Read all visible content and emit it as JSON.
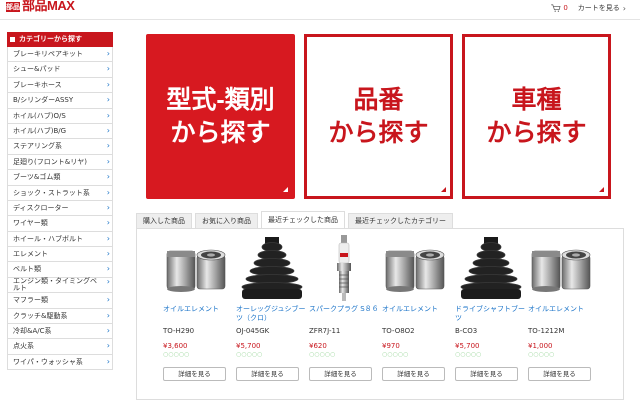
{
  "header": {
    "logo_badge": "部品",
    "logo_text": "部品MAX",
    "cart_count": "0",
    "cart_label": "カートを見る"
  },
  "sidebar": {
    "title": "カテゴリーから探す",
    "items": [
      {
        "label": "ブレーキリペアキット"
      },
      {
        "label": "シュー&パッド"
      },
      {
        "label": "ブレーキホース"
      },
      {
        "label": "B/シリンダーASSY"
      },
      {
        "label": "ホイル(ハブ)O/S"
      },
      {
        "label": "ホイル(ハブ)B/G"
      },
      {
        "label": "ステアリング系"
      },
      {
        "label": "足廻り(フロント&リヤ)"
      },
      {
        "label": "ブーツ&ゴム類"
      },
      {
        "label": "ショック・ストラット系"
      },
      {
        "label": "ディスクローター"
      },
      {
        "label": "ワイヤー類"
      },
      {
        "label": "ホイール・ハブボルト"
      },
      {
        "label": "エレメント"
      },
      {
        "label": "ベルト類"
      },
      {
        "label": "エンジン類・タイミングベルト"
      },
      {
        "label": "マフラー類"
      },
      {
        "label": "クラッチ&駆動系"
      },
      {
        "label": "冷却&A/C系"
      },
      {
        "label": "点火系"
      },
      {
        "label": "ワイパ・ウォッシャ系"
      }
    ]
  },
  "search_buttons": [
    {
      "line1": "型式-類別",
      "line2": "から探す"
    },
    {
      "line1": "品番",
      "line2": "から探す"
    },
    {
      "line1": "車種",
      "line2": "から探す"
    }
  ],
  "tabs": [
    {
      "label": "購入した商品"
    },
    {
      "label": "お気に入り商品"
    },
    {
      "label": "最近チェックした商品"
    },
    {
      "label": "最近チェックしたカテゴリー"
    }
  ],
  "products": [
    {
      "name": "オイルエレメント",
      "code": "TO-H290",
      "price": "¥3,600",
      "image_icon": "oil-filter-icon",
      "stars": "○○○○○",
      "button": "詳細を見る"
    },
    {
      "name": "オーレッグジュシブーツ（クロ）",
      "code": "OJ-045GK",
      "price": "¥5,700",
      "image_icon": "cv-boot-icon",
      "stars": "○○○○○",
      "button": "詳細を見る"
    },
    {
      "name": "スパークプラグ S８６",
      "code": "ZFR7J-11",
      "price": "¥620",
      "image_icon": "spark-plug-icon",
      "stars": "○○○○○",
      "button": "詳細を見る"
    },
    {
      "name": "オイルエレメント",
      "code": "TO-O8O2",
      "price": "¥970",
      "image_icon": "oil-filter-icon",
      "stars": "○○○○○",
      "button": "詳細を見る"
    },
    {
      "name": "ドライブシャフトブーツ",
      "code": "B-CO3",
      "price": "¥5,700",
      "image_icon": "cv-boot-icon",
      "stars": "○○○○○",
      "button": "詳細を見る"
    },
    {
      "name": "オイルエレメント",
      "code": "TO-1212M",
      "price": "¥1,000",
      "image_icon": "oil-filter-icon",
      "stars": "○○○○○",
      "button": "詳細を見る"
    }
  ],
  "colors": {
    "brand": "#c8161d",
    "link": "#1a73c8"
  }
}
